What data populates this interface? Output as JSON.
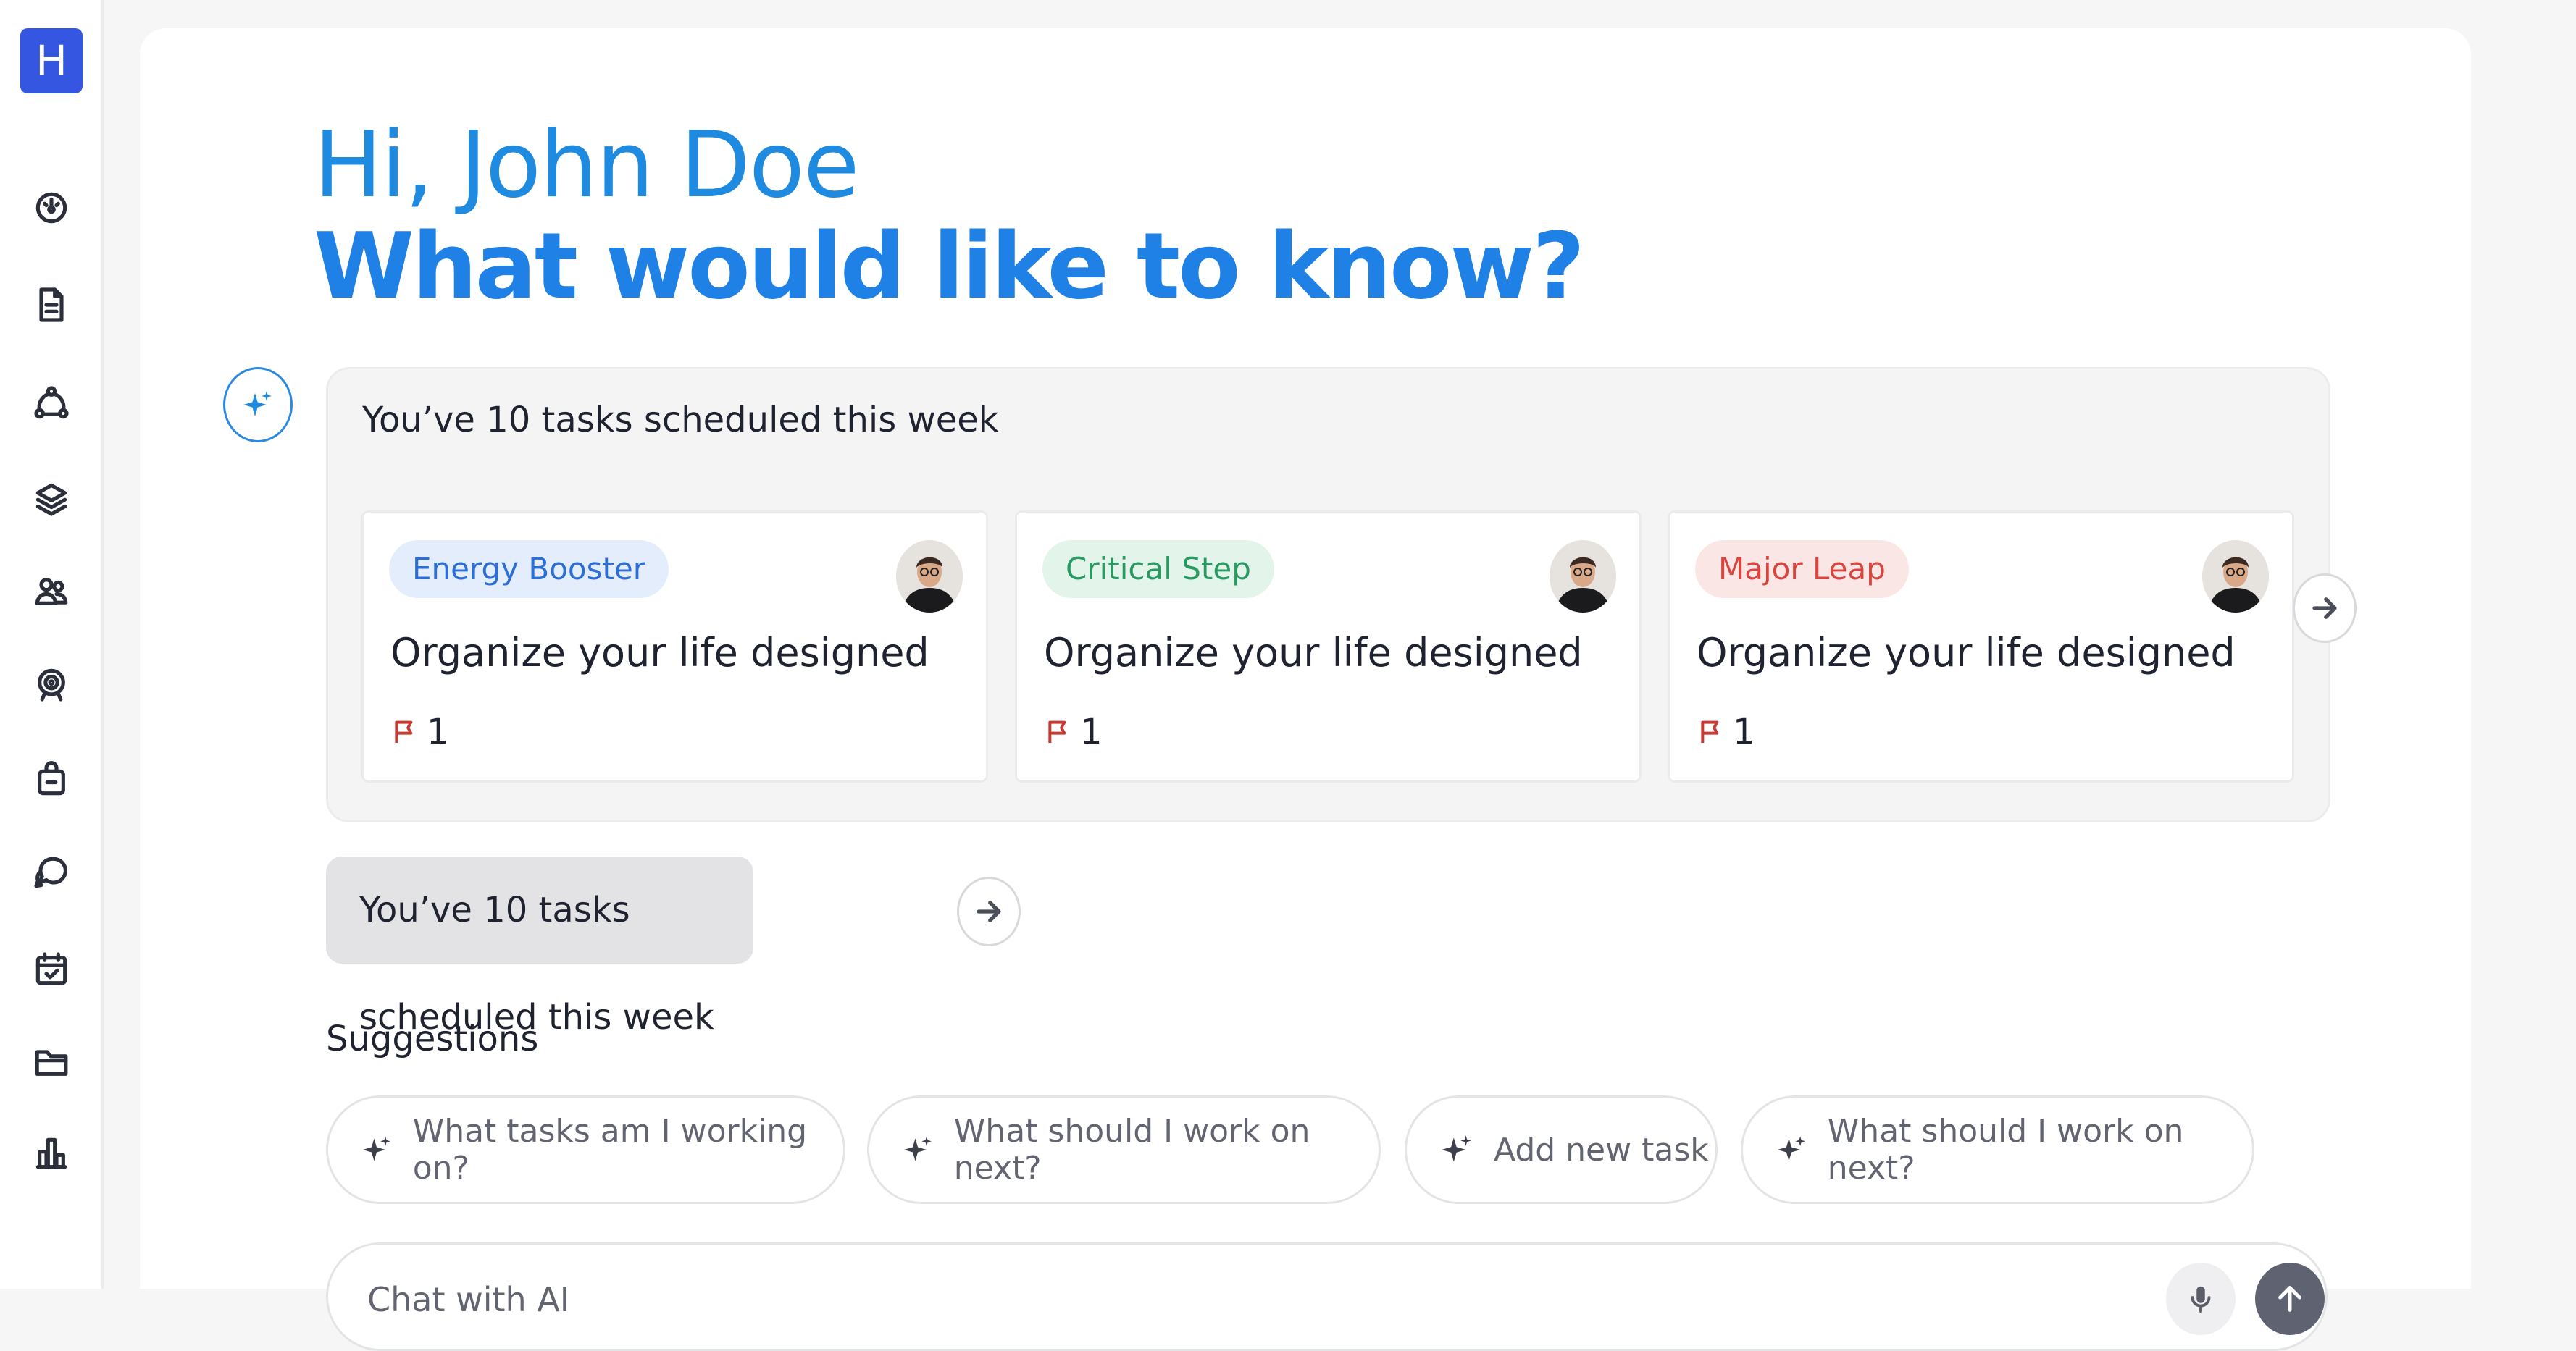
{
  "app": {
    "logo_letter": "H",
    "brand_color": "#3556e0",
    "accent_color": "#1f80e6"
  },
  "sidebar": {
    "items": [
      {
        "name": "dashboard-gauge-icon"
      },
      {
        "name": "document-icon"
      },
      {
        "name": "network-icon"
      },
      {
        "name": "layers-icon"
      },
      {
        "name": "users-icon"
      },
      {
        "name": "target-icon"
      },
      {
        "name": "briefcase-icon"
      },
      {
        "name": "chat-icon"
      },
      {
        "name": "calendar-check-icon"
      },
      {
        "name": "folder-icon"
      },
      {
        "name": "bar-chart-icon"
      }
    ]
  },
  "header": {
    "greeting": "Hi, John Doe",
    "question": "What would like to know?"
  },
  "assistant": {
    "summary": "You’ve 10 tasks scheduled this week",
    "cards": [
      {
        "tag": "Energy Booster",
        "tag_color": "#2b6fd6",
        "tag_bg": "#e4edfc",
        "title": "Organize your life designed",
        "flag_count": "1"
      },
      {
        "tag": "Critical Step",
        "tag_color": "#2a9a63",
        "tag_bg": "#e3f4ea",
        "title": "Organize your life designed",
        "flag_count": "1"
      },
      {
        "tag": "Major Leap",
        "tag_color": "#d8453f",
        "tag_bg": "#fbe6e6",
        "title": "Organize your life designed",
        "flag_count": "1"
      }
    ]
  },
  "user_message": {
    "text": "You’ve 10 tasks scheduled this week"
  },
  "suggestions": {
    "label": "Suggestions",
    "items": [
      {
        "text": "What tasks am I working on?"
      },
      {
        "text": "What should I work on next?"
      },
      {
        "text": "Add new task"
      },
      {
        "text": "What should I work on next?"
      }
    ]
  },
  "chat": {
    "placeholder": "Chat with AI"
  }
}
